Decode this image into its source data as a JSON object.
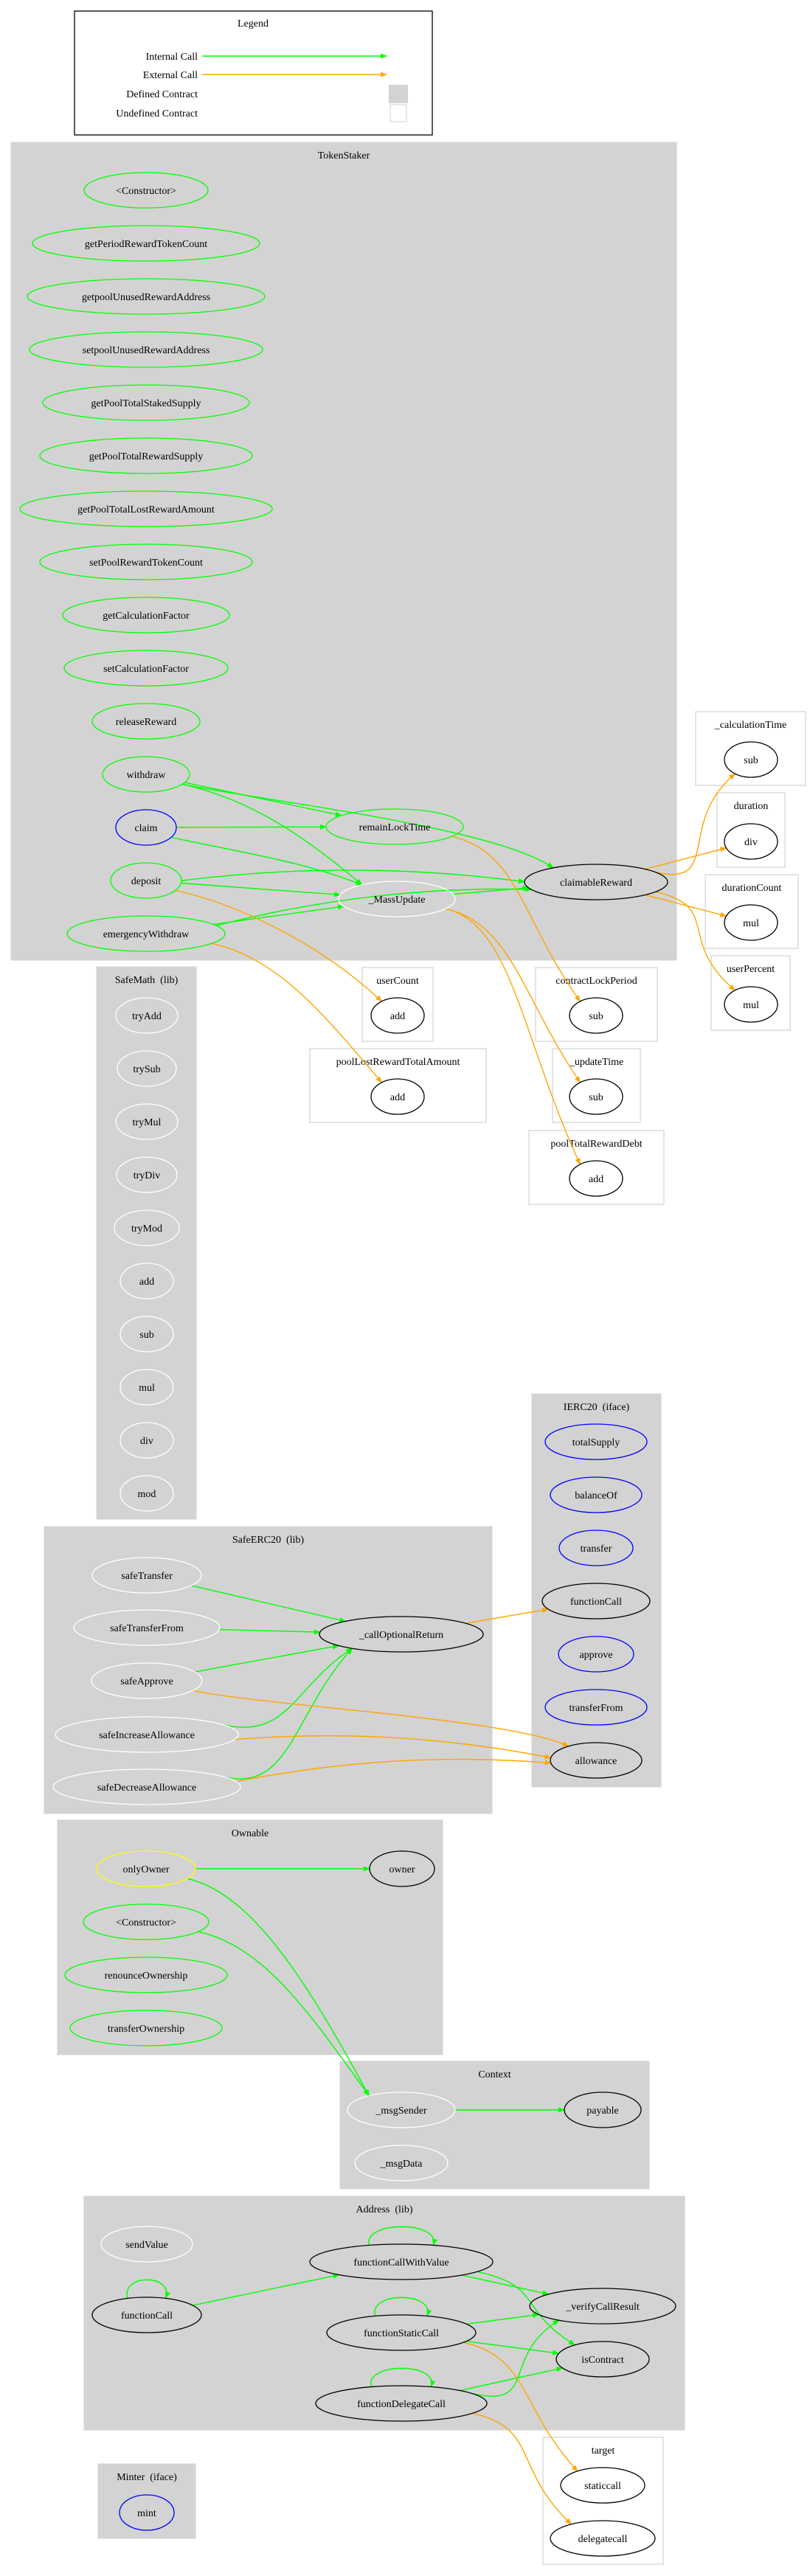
{
  "colors": {
    "internal_call": "#00ff00",
    "external_call": "#ffa500",
    "defined_contract_fill": "#d3d3d3",
    "undefined_contract_border": "#d8d8d8",
    "public_function": "#00ff00",
    "external_function": "#0000ff",
    "internal_function": "#ffffff",
    "modifier": "#ffff00",
    "external_target": "#000000"
  },
  "legend": {
    "title": "Legend",
    "items": [
      {
        "label": "Internal Call",
        "kind": "internal"
      },
      {
        "label": "External Call",
        "kind": "external"
      },
      {
        "label": "Defined Contract",
        "kind": "defined"
      },
      {
        "label": "Undefined Contract",
        "kind": "undefined"
      }
    ]
  },
  "clusters": [
    {
      "id": "TokenStaker",
      "title": "TokenStaker",
      "defined": true,
      "nodes": [
        {
          "id": "ts_ctor",
          "label": "<Constructor>",
          "kind": "public"
        },
        {
          "id": "ts_getPeriod",
          "label": "getPeriodRewardTokenCount",
          "kind": "public"
        },
        {
          "id": "ts_getUnused",
          "label": "getpoolUnusedRewardAddress",
          "kind": "public"
        },
        {
          "id": "ts_setUnused",
          "label": "setpoolUnusedRewardAddress",
          "kind": "public"
        },
        {
          "id": "ts_getStaked",
          "label": "getPoolTotalStakedSupply",
          "kind": "public"
        },
        {
          "id": "ts_getReward",
          "label": "getPoolTotalRewardSupply",
          "kind": "public"
        },
        {
          "id": "ts_getLost",
          "label": "getPoolTotalLostRewardAmount",
          "kind": "public"
        },
        {
          "id": "ts_setRewardCount",
          "label": "setPoolRewardTokenCount",
          "kind": "public"
        },
        {
          "id": "ts_getCalc",
          "label": "getCalculationFactor",
          "kind": "public"
        },
        {
          "id": "ts_setCalc",
          "label": "setCalculationFactor",
          "kind": "public"
        },
        {
          "id": "ts_release",
          "label": "releaseReward",
          "kind": "public"
        },
        {
          "id": "ts_withdraw",
          "label": "withdraw",
          "kind": "public"
        },
        {
          "id": "ts_claim",
          "label": "claim",
          "kind": "external"
        },
        {
          "id": "ts_deposit",
          "label": "deposit",
          "kind": "public"
        },
        {
          "id": "ts_emergency",
          "label": "emergencyWithdraw",
          "kind": "public"
        },
        {
          "id": "ts_remain",
          "label": "remainLockTime",
          "kind": "public"
        },
        {
          "id": "ts_mass",
          "label": "_MassUpdate",
          "kind": "internal"
        },
        {
          "id": "ts_claimable",
          "label": "claimableReward",
          "kind": "target"
        }
      ]
    },
    {
      "id": "calculationTime",
      "title": "_calculationTime",
      "defined": false,
      "nodes": [
        {
          "id": "ct_sub",
          "label": "sub",
          "kind": "target"
        }
      ]
    },
    {
      "id": "duration",
      "title": "duration",
      "defined": false,
      "nodes": [
        {
          "id": "du_div",
          "label": "div",
          "kind": "target"
        }
      ]
    },
    {
      "id": "durationCount",
      "title": "durationCount",
      "defined": false,
      "nodes": [
        {
          "id": "dc_mul",
          "label": "mul",
          "kind": "target"
        }
      ]
    },
    {
      "id": "userPercent",
      "title": "userPercent",
      "defined": false,
      "nodes": [
        {
          "id": "up_mul",
          "label": "mul",
          "kind": "target"
        }
      ]
    },
    {
      "id": "userCount",
      "title": "userCount",
      "defined": false,
      "nodes": [
        {
          "id": "uc_add",
          "label": "add",
          "kind": "target"
        }
      ]
    },
    {
      "id": "contractLockPeriod",
      "title": "contractLockPeriod",
      "defined": false,
      "nodes": [
        {
          "id": "cl_sub",
          "label": "sub",
          "kind": "target"
        }
      ]
    },
    {
      "id": "poolLostRewardTotalAmount",
      "title": "poolLostRewardTotalAmount",
      "defined": false,
      "nodes": [
        {
          "id": "pl_add",
          "label": "add",
          "kind": "target"
        }
      ]
    },
    {
      "id": "updateTime",
      "title": "_updateTime",
      "defined": false,
      "nodes": [
        {
          "id": "ut_sub",
          "label": "sub",
          "kind": "target"
        }
      ]
    },
    {
      "id": "poolTotalRewardDebt",
      "title": "poolTotalRewardDebt",
      "defined": false,
      "nodes": [
        {
          "id": "pd_add",
          "label": "add",
          "kind": "target"
        }
      ]
    },
    {
      "id": "SafeMath",
      "title": "SafeMath  (lib)",
      "defined": true,
      "nodes": [
        {
          "id": "sm_tryAdd",
          "label": "tryAdd",
          "kind": "internal"
        },
        {
          "id": "sm_trySub",
          "label": "trySub",
          "kind": "internal"
        },
        {
          "id": "sm_tryMul",
          "label": "tryMul",
          "kind": "internal"
        },
        {
          "id": "sm_tryDiv",
          "label": "tryDiv",
          "kind": "internal"
        },
        {
          "id": "sm_tryMod",
          "label": "tryMod",
          "kind": "internal"
        },
        {
          "id": "sm_add",
          "label": "add",
          "kind": "internal"
        },
        {
          "id": "sm_sub",
          "label": "sub",
          "kind": "internal"
        },
        {
          "id": "sm_mul",
          "label": "mul",
          "kind": "internal"
        },
        {
          "id": "sm_div",
          "label": "div",
          "kind": "internal"
        },
        {
          "id": "sm_mod",
          "label": "mod",
          "kind": "internal"
        }
      ]
    },
    {
      "id": "IERC20",
      "title": "IERC20  (iface)",
      "defined": true,
      "nodes": [
        {
          "id": "ie_totalSupply",
          "label": "totalSupply",
          "kind": "external"
        },
        {
          "id": "ie_balanceOf",
          "label": "balanceOf",
          "kind": "external"
        },
        {
          "id": "ie_transfer",
          "label": "transfer",
          "kind": "external"
        },
        {
          "id": "ie_functionCall",
          "label": "functionCall",
          "kind": "target"
        },
        {
          "id": "ie_approve",
          "label": "approve",
          "kind": "external"
        },
        {
          "id": "ie_transferFrom",
          "label": "transferFrom",
          "kind": "external"
        },
        {
          "id": "ie_allowance",
          "label": "allowance",
          "kind": "target"
        }
      ]
    },
    {
      "id": "SafeERC20",
      "title": "SafeERC20  (lib)",
      "defined": true,
      "nodes": [
        {
          "id": "se_safeTransfer",
          "label": "safeTransfer",
          "kind": "internal"
        },
        {
          "id": "se_safeTransferFrom",
          "label": "safeTransferFrom",
          "kind": "internal"
        },
        {
          "id": "se_safeApprove",
          "label": "safeApprove",
          "kind": "internal"
        },
        {
          "id": "se_safeIncrease",
          "label": "safeIncreaseAllowance",
          "kind": "internal"
        },
        {
          "id": "se_safeDecrease",
          "label": "safeDecreaseAllowance",
          "kind": "internal"
        },
        {
          "id": "se_callOptional",
          "label": "_callOptionalReturn",
          "kind": "target"
        }
      ]
    },
    {
      "id": "Ownable",
      "title": "Ownable",
      "defined": true,
      "nodes": [
        {
          "id": "ow_onlyOwner",
          "label": "onlyOwner",
          "kind": "modifier"
        },
        {
          "id": "ow_owner",
          "label": "owner",
          "kind": "target"
        },
        {
          "id": "ow_ctor",
          "label": "<Constructor>",
          "kind": "public"
        },
        {
          "id": "ow_renounce",
          "label": "renounceOwnership",
          "kind": "public"
        },
        {
          "id": "ow_transfer",
          "label": "transferOwnership",
          "kind": "public"
        }
      ]
    },
    {
      "id": "Context",
      "title": "Context",
      "defined": true,
      "nodes": [
        {
          "id": "cx_msgSender",
          "label": "_msgSender",
          "kind": "internal"
        },
        {
          "id": "cx_payable",
          "label": "payable",
          "kind": "target"
        },
        {
          "id": "cx_msgData",
          "label": "_msgData",
          "kind": "internal"
        }
      ]
    },
    {
      "id": "Address",
      "title": "Address  (lib)",
      "defined": true,
      "nodes": [
        {
          "id": "ad_sendValue",
          "label": "sendValue",
          "kind": "internal"
        },
        {
          "id": "ad_fcwv",
          "label": "functionCallWithValue",
          "kind": "target"
        },
        {
          "id": "ad_functionCall",
          "label": "functionCall",
          "kind": "target"
        },
        {
          "id": "ad_staticCall",
          "label": "functionStaticCall",
          "kind": "target"
        },
        {
          "id": "ad_verify",
          "label": "_verifyCallResult",
          "kind": "target"
        },
        {
          "id": "ad_isContract",
          "label": "isContract",
          "kind": "target"
        },
        {
          "id": "ad_delegateCall",
          "label": "functionDelegateCall",
          "kind": "target"
        }
      ]
    },
    {
      "id": "target",
      "title": "target",
      "defined": false,
      "nodes": [
        {
          "id": "tg_staticcall",
          "label": "staticcall",
          "kind": "target"
        },
        {
          "id": "tg_delegatecall",
          "label": "delegatecall",
          "kind": "target"
        }
      ]
    },
    {
      "id": "Minter",
      "title": "Minter  (iface)",
      "defined": true,
      "nodes": [
        {
          "id": "mi_mint",
          "label": "mint",
          "kind": "external"
        }
      ]
    }
  ],
  "edges": [
    {
      "from": "ts_withdraw",
      "to": "ts_claimable",
      "type": "internal"
    },
    {
      "from": "ts_withdraw",
      "to": "ts_remain",
      "type": "internal"
    },
    {
      "from": "ts_withdraw",
      "to": "ts_mass",
      "type": "internal"
    },
    {
      "from": "ts_claim",
      "to": "ts_remain",
      "type": "internal"
    },
    {
      "from": "ts_claim",
      "to": "ts_mass",
      "type": "internal"
    },
    {
      "from": "ts_deposit",
      "to": "ts_claimable",
      "type": "internal"
    },
    {
      "from": "ts_deposit",
      "to": "ts_mass",
      "type": "internal"
    },
    {
      "from": "ts_emergency",
      "to": "ts_mass",
      "type": "internal"
    },
    {
      "from": "ts_emergency",
      "to": "ts_claimable",
      "type": "internal"
    },
    {
      "from": "ts_mass",
      "to": "ts_claimable",
      "type": "internal"
    },
    {
      "from": "ts_claimable",
      "to": "ct_sub",
      "type": "external"
    },
    {
      "from": "ts_claimable",
      "to": "du_div",
      "type": "external"
    },
    {
      "from": "ts_claimable",
      "to": "dc_mul",
      "type": "external"
    },
    {
      "from": "ts_claimable",
      "to": "up_mul",
      "type": "external"
    },
    {
      "from": "ts_remain",
      "to": "cl_sub",
      "type": "external"
    },
    {
      "from": "ts_deposit",
      "to": "uc_add",
      "type": "external"
    },
    {
      "from": "ts_emergency",
      "to": "pl_add",
      "type": "external"
    },
    {
      "from": "ts_mass",
      "to": "ut_sub",
      "type": "external"
    },
    {
      "from": "ts_mass",
      "to": "pd_add",
      "type": "external"
    },
    {
      "from": "se_safeTransfer",
      "to": "se_callOptional",
      "type": "internal"
    },
    {
      "from": "se_safeTransferFrom",
      "to": "se_callOptional",
      "type": "internal"
    },
    {
      "from": "se_safeApprove",
      "to": "se_callOptional",
      "type": "internal"
    },
    {
      "from": "se_safeIncrease",
      "to": "se_callOptional",
      "type": "internal"
    },
    {
      "from": "se_safeDecrease",
      "to": "se_callOptional",
      "type": "internal"
    },
    {
      "from": "se_callOptional",
      "to": "ie_functionCall",
      "type": "external"
    },
    {
      "from": "se_safeApprove",
      "to": "ie_allowance",
      "type": "external"
    },
    {
      "from": "se_safeIncrease",
      "to": "ie_allowance",
      "type": "external"
    },
    {
      "from": "se_safeDecrease",
      "to": "ie_allowance",
      "type": "external"
    },
    {
      "from": "ow_onlyOwner",
      "to": "ow_owner",
      "type": "internal"
    },
    {
      "from": "ow_onlyOwner",
      "to": "cx_msgSender",
      "type": "internal"
    },
    {
      "from": "ow_ctor",
      "to": "cx_msgSender",
      "type": "internal"
    },
    {
      "from": "cx_msgSender",
      "to": "cx_payable",
      "type": "internal"
    },
    {
      "from": "ad_functionCall",
      "to": "ad_functionCall",
      "type": "internal"
    },
    {
      "from": "ad_functionCall",
      "to": "ad_fcwv",
      "type": "internal"
    },
    {
      "from": "ad_fcwv",
      "to": "ad_fcwv",
      "type": "internal"
    },
    {
      "from": "ad_fcwv",
      "to": "ad_verify",
      "type": "internal"
    },
    {
      "from": "ad_fcwv",
      "to": "ad_isContract",
      "type": "internal"
    },
    {
      "from": "ad_staticCall",
      "to": "ad_staticCall",
      "type": "internal"
    },
    {
      "from": "ad_staticCall",
      "to": "ad_verify",
      "type": "internal"
    },
    {
      "from": "ad_staticCall",
      "to": "ad_isContract",
      "type": "internal"
    },
    {
      "from": "ad_delegateCall",
      "to": "ad_delegateCall",
      "type": "internal"
    },
    {
      "from": "ad_delegateCall",
      "to": "ad_verify",
      "type": "internal"
    },
    {
      "from": "ad_delegateCall",
      "to": "ad_isContract",
      "type": "internal"
    },
    {
      "from": "ad_staticCall",
      "to": "tg_staticcall",
      "type": "external"
    },
    {
      "from": "ad_delegateCall",
      "to": "tg_delegatecall",
      "type": "external"
    }
  ]
}
